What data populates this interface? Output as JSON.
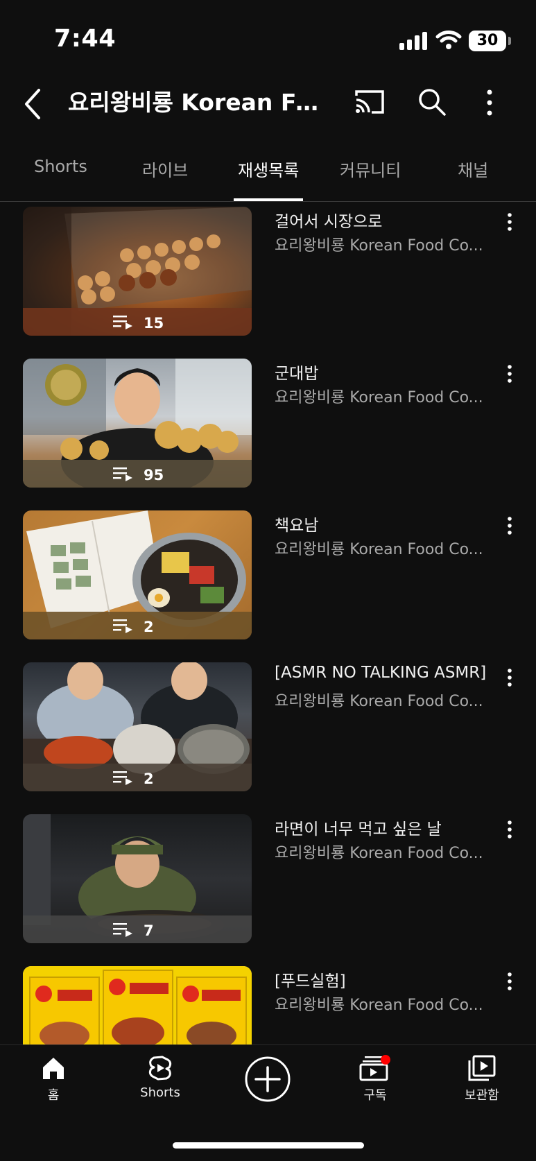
{
  "status_bar": {
    "time": "7:44",
    "battery": "30"
  },
  "header": {
    "title": "요리왕비룡 Korean Foo..."
  },
  "tabs": [
    {
      "label": "Shorts",
      "active": false
    },
    {
      "label": "라이브",
      "active": false
    },
    {
      "label": "재생목록",
      "active": true
    },
    {
      "label": "커뮤니티",
      "active": false
    },
    {
      "label": "채널",
      "active": false
    }
  ],
  "playlists": [
    {
      "title": "걸어서 시장으로",
      "channel": "요리왕비룡 Korean Food Co...",
      "count": "15"
    },
    {
      "title": "군대밥",
      "channel": "요리왕비룡 Korean Food Co...",
      "count": "95"
    },
    {
      "title": "책요남",
      "channel": "요리왕비룡 Korean Food Co...",
      "count": "2"
    },
    {
      "title": "[ASMR NO TALKING ASMR]",
      "channel": "요리왕비룡 Korean Food Co...",
      "count": "2"
    },
    {
      "title": "라면이 너무 먹고 싶은 날",
      "channel": "요리왕비룡 Korean Food Co...",
      "count": "7"
    },
    {
      "title": "[푸드실험]",
      "channel": "요리왕비룡 Korean Food Co...",
      "count": ""
    }
  ],
  "bottom_nav": {
    "home": "홈",
    "shorts": "Shorts",
    "subscriptions": "구독",
    "library": "보관함"
  },
  "colors": {
    "background": "#0f0f0f",
    "text_primary": "#f1f1f1",
    "text_secondary": "#aaaaaa",
    "notification_dot": "#ff0000"
  }
}
